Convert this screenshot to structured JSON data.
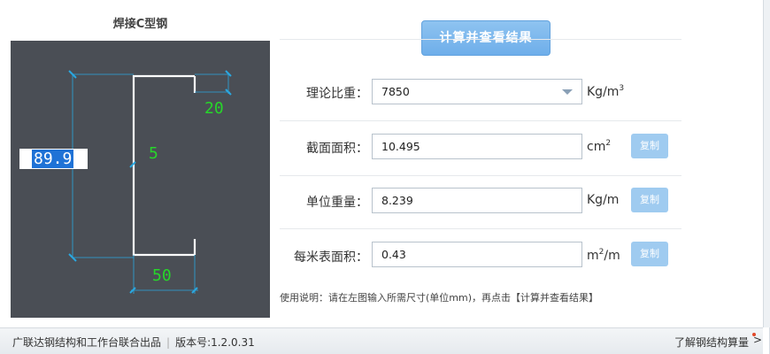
{
  "title": "焊接C型钢",
  "drawing": {
    "dims": {
      "height": "89.9",
      "flange": "20",
      "thickness": "5",
      "width": "50"
    },
    "line_color": "#ffffff",
    "dim_color": "#2aa7e0",
    "dim_text_color": "#27d62a",
    "background": "#4a4e55"
  },
  "calc_button": "计算并查看结果",
  "rows": [
    {
      "label": "理论比重：",
      "value": "7850",
      "unit": "Kg/m",
      "unit_sup": "3",
      "has_dropdown": true,
      "copy": ""
    },
    {
      "label": "截面面积：",
      "value": "10.495",
      "unit": "cm",
      "unit_sup": "2",
      "has_dropdown": false,
      "copy": "复制"
    },
    {
      "label": "单位重量：",
      "value": "8.239",
      "unit": "Kg/m",
      "unit_sup": "",
      "has_dropdown": false,
      "copy": "复制"
    },
    {
      "label": "每米表面积：",
      "value": "0.43",
      "unit_pre": "m",
      "unit_sup": "2",
      "unit_post": "/m",
      "has_dropdown": false,
      "copy": "复制"
    }
  ],
  "usage": "使用说明：请在左图输入所需尺寸(单位mm)，再点击【计算并查看结果】",
  "footer": {
    "credit": "广联达钢结构和工作台联合出品",
    "version": "版本号:1.2.0.31",
    "link": "了解钢结构算量"
  }
}
